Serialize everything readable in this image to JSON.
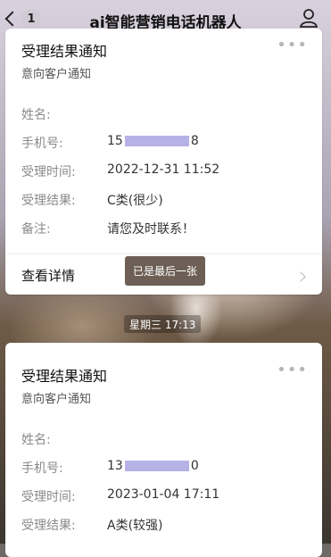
{
  "nav": {
    "badge_count": "1",
    "title": "ai智能营销电话机器人"
  },
  "cards": [
    {
      "title": "受理结果通知",
      "subtitle": "意向客户通知",
      "more": "•••",
      "fields": [
        {
          "key": "姓名:",
          "value": ""
        },
        {
          "key": "手机号:",
          "value_prefix": "15",
          "value_suffix": "8"
        },
        {
          "key": "受理时间:",
          "value": "2022-12-31 11:52"
        },
        {
          "key": "受理结果:",
          "value": "C类(很少)"
        },
        {
          "key": "备注:",
          "value": "请您及时联系！"
        }
      ],
      "detail_label": "查看详情"
    },
    {
      "title": "受理结果通知",
      "subtitle": "意向客户通知",
      "more": "•••",
      "fields": [
        {
          "key": "姓名:",
          "value": ""
        },
        {
          "key": "手机号:",
          "value_prefix": "13",
          "value_suffix": "0"
        },
        {
          "key": "受理时间:",
          "value": "2023-01-04 17:11"
        },
        {
          "key": "受理结果:",
          "value": "A类(较强)"
        }
      ]
    }
  ],
  "toast": "已是最后一张",
  "timestamp": "星期三 17:13",
  "colors": {
    "mask": "#b7b2e6",
    "toast_bg": "#6d5f55"
  }
}
